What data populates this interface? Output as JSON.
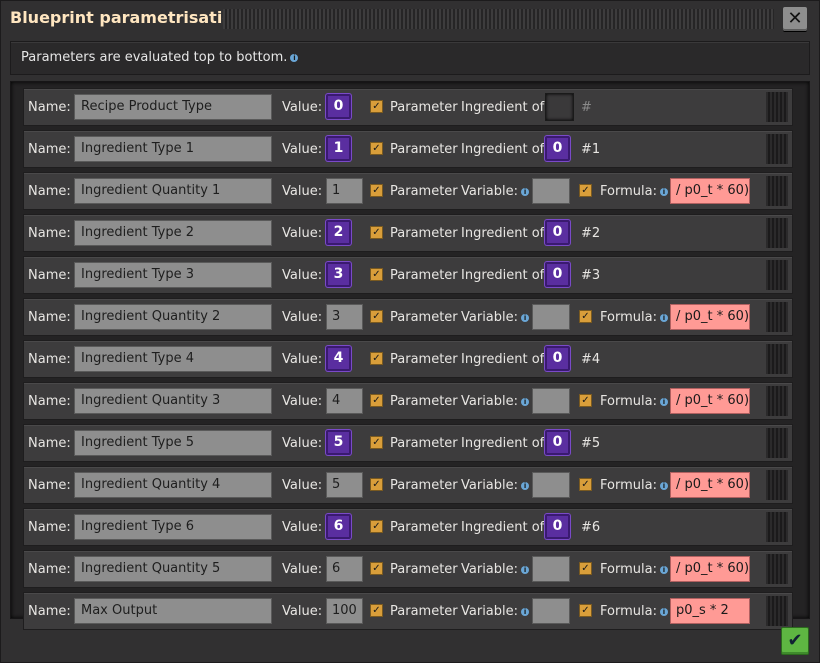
{
  "window": {
    "title": "Blueprint parametrisation",
    "close_label": "✕",
    "confirm_label": "✔"
  },
  "subheader": {
    "text": "Parameters are evaluated top to bottom."
  },
  "labels": {
    "name": "Name:",
    "value": "Value:",
    "parameter": "Parameter",
    "ingredient_of": "Ingredient of:",
    "variable": "Variable:",
    "formula": "Formula:"
  },
  "colors": {
    "accent_purple": "#5a2ea0",
    "checkbox_orange": "#d99e3a",
    "formula_pink": "#ff9a95",
    "confirm_green": "#5eb642"
  },
  "rows": [
    {
      "name": "Recipe Product Type",
      "kind": "item",
      "value": "0",
      "parameter": true,
      "ingredient_of": "",
      "ref": "#"
    },
    {
      "name": "Ingredient Type 1",
      "kind": "item",
      "value": "1",
      "parameter": true,
      "ingredient_of": "0",
      "ref": "#1"
    },
    {
      "name": "Ingredient Quantity 1",
      "kind": "number",
      "value": "1",
      "parameter": true,
      "formula_enabled": true,
      "formula": "/ p0_t * 60)"
    },
    {
      "name": "Ingredient Type 2",
      "kind": "item",
      "value": "2",
      "parameter": true,
      "ingredient_of": "0",
      "ref": "#2"
    },
    {
      "name": "Ingredient Type 3",
      "kind": "item",
      "value": "3",
      "parameter": true,
      "ingredient_of": "0",
      "ref": "#3"
    },
    {
      "name": "Ingredient Quantity 2",
      "kind": "number",
      "value": "3",
      "parameter": true,
      "formula_enabled": true,
      "formula": "/ p0_t * 60)"
    },
    {
      "name": "Ingredient Type 4",
      "kind": "item",
      "value": "4",
      "parameter": true,
      "ingredient_of": "0",
      "ref": "#4"
    },
    {
      "name": "Ingredient Quantity 3",
      "kind": "number",
      "value": "4",
      "parameter": true,
      "formula_enabled": true,
      "formula": "/ p0_t * 60)"
    },
    {
      "name": "Ingredient Type 5",
      "kind": "item",
      "value": "5",
      "parameter": true,
      "ingredient_of": "0",
      "ref": "#5"
    },
    {
      "name": "Ingredient Quantity 4",
      "kind": "number",
      "value": "5",
      "parameter": true,
      "formula_enabled": true,
      "formula": "/ p0_t * 60)"
    },
    {
      "name": "Ingredient Type 6",
      "kind": "item",
      "value": "6",
      "parameter": true,
      "ingredient_of": "0",
      "ref": "#6"
    },
    {
      "name": "Ingredient Quantity 5",
      "kind": "number",
      "value": "6",
      "parameter": true,
      "formula_enabled": true,
      "formula": "/ p0_t * 60)"
    },
    {
      "name": "Max Output",
      "kind": "number",
      "value": "100",
      "parameter": true,
      "formula_enabled": true,
      "formula": "p0_s * 2"
    }
  ]
}
